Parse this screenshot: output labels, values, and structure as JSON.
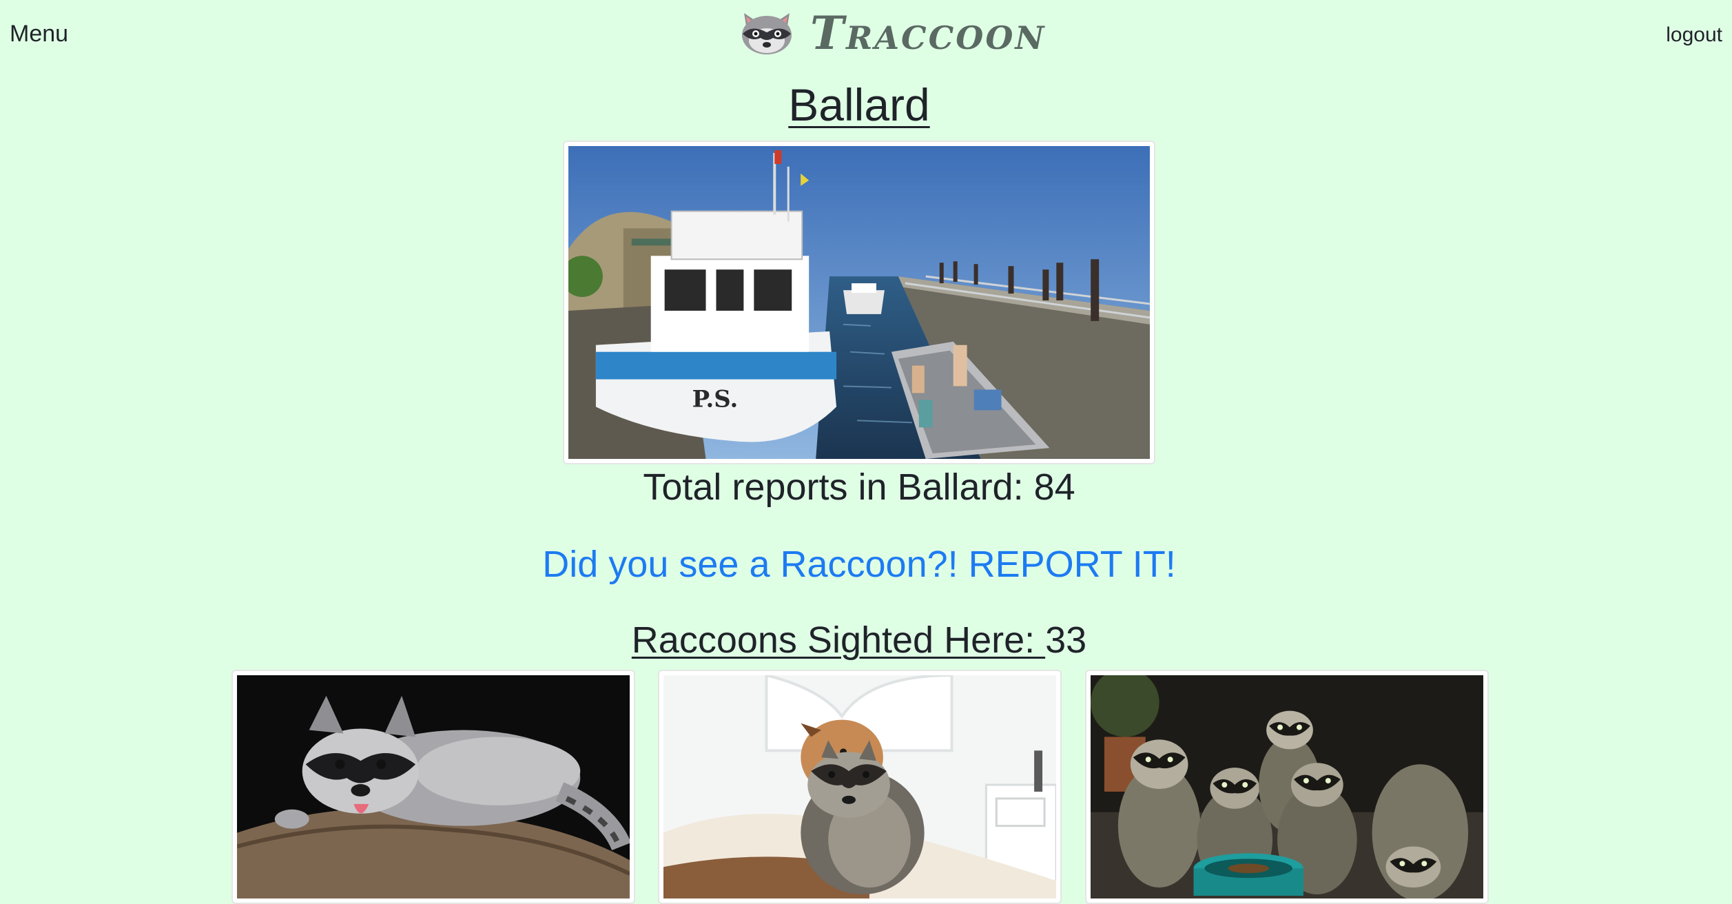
{
  "nav": {
    "menu_label": "Menu",
    "brand_name": "Traccoon",
    "brand_icon": "raccoon-face-icon",
    "logout_label": "logout"
  },
  "location": {
    "name": "Ballard",
    "hero_image": "ballard-locks-photo",
    "total_reports_text": "Total reports in Ballard: 84"
  },
  "report_cta": "Did you see a Raccoon?! REPORT IT!",
  "sightings": {
    "label": "Raccoons Sighted Here: ",
    "count": "33",
    "photos": [
      "raccoon-on-log-photo",
      "raccoon-with-dog-photo",
      "raccoon-family-photo"
    ]
  },
  "colors": {
    "background": "#dfffe5",
    "link": "#1d7bf2",
    "text": "#1f2329",
    "brand_text": "#5a6a63"
  }
}
